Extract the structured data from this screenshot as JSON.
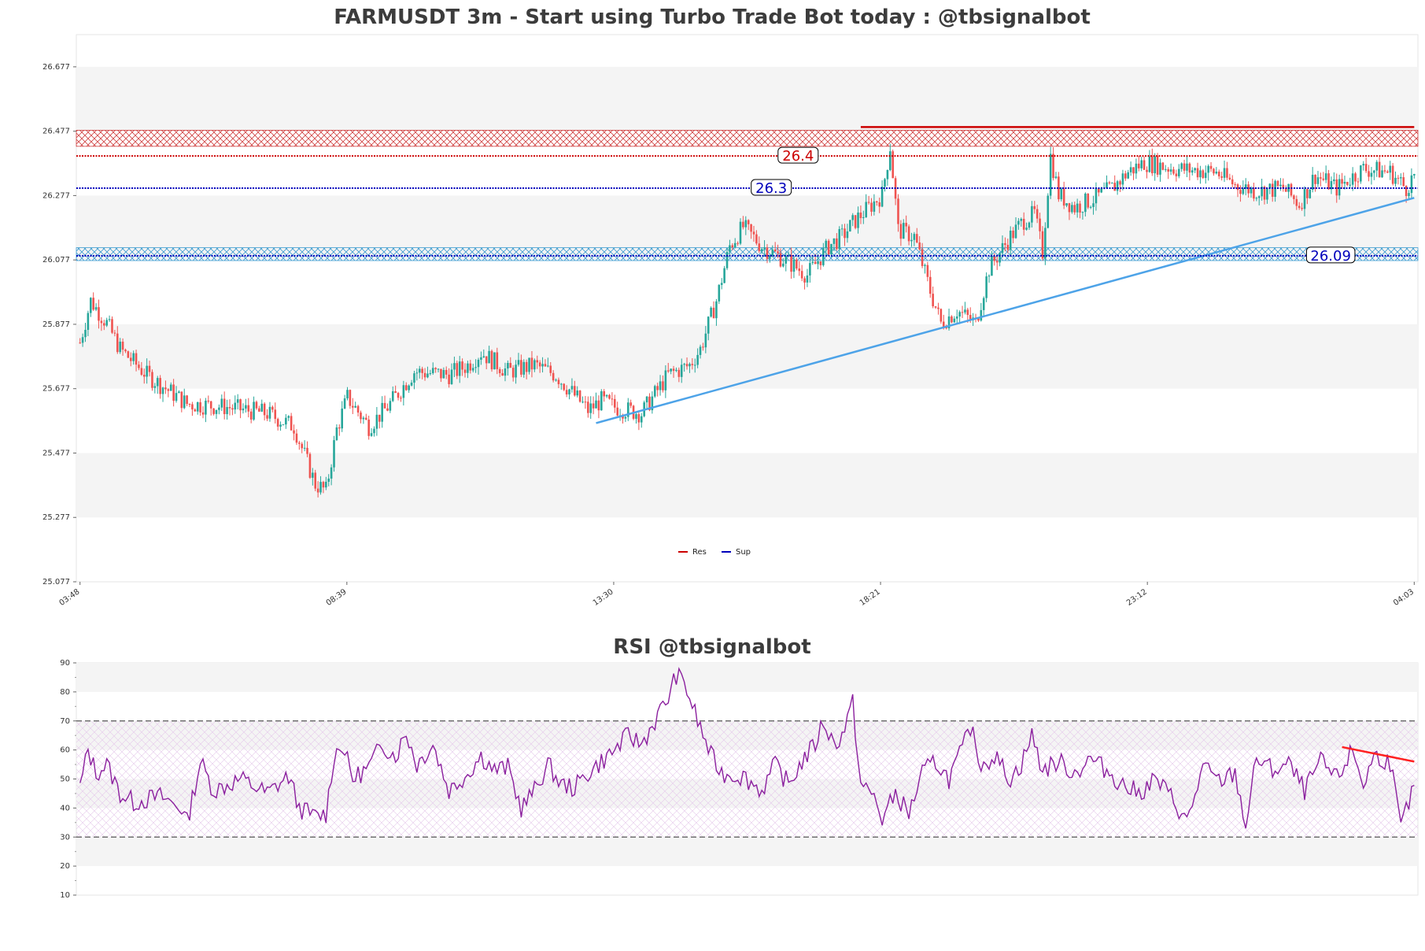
{
  "chart_data": [
    {
      "type": "candlestick",
      "title": "FARMUSDT 3m - Start using Turbo Trade Bot today : @tbsignalbot",
      "ylim": [
        25.077,
        26.777
      ],
      "y_ticks": [
        25.077,
        25.277,
        25.477,
        25.677,
        25.877,
        26.077,
        26.277,
        26.477,
        26.677
      ],
      "x_ticks": [
        "03:48",
        "08:39",
        "13:30",
        "18:21",
        "23:12",
        "04:03"
      ],
      "candle_count": 500,
      "price_path": [
        [
          0,
          25.82
        ],
        [
          4,
          25.95
        ],
        [
          10,
          25.88
        ],
        [
          15,
          25.8
        ],
        [
          25,
          25.72
        ],
        [
          40,
          25.63
        ],
        [
          55,
          25.62
        ],
        [
          70,
          25.6
        ],
        [
          80,
          25.56
        ],
        [
          88,
          25.38
        ],
        [
          92,
          25.36
        ],
        [
          96,
          25.55
        ],
        [
          100,
          25.65
        ],
        [
          108,
          25.56
        ],
        [
          115,
          25.62
        ],
        [
          125,
          25.73
        ],
        [
          138,
          25.72
        ],
        [
          145,
          25.75
        ],
        [
          150,
          25.79
        ],
        [
          160,
          25.73
        ],
        [
          170,
          25.75
        ],
        [
          178,
          25.72
        ],
        [
          190,
          25.61
        ],
        [
          195,
          25.64
        ],
        [
          200,
          25.62
        ],
        [
          210,
          25.6
        ],
        [
          215,
          25.66
        ],
        [
          220,
          25.72
        ],
        [
          228,
          25.75
        ],
        [
          232,
          25.8
        ],
        [
          238,
          25.95
        ],
        [
          243,
          26.12
        ],
        [
          248,
          26.18
        ],
        [
          255,
          26.12
        ],
        [
          265,
          26.07
        ],
        [
          272,
          26.03
        ],
        [
          280,
          26.12
        ],
        [
          285,
          26.15
        ],
        [
          290,
          26.2
        ],
        [
          295,
          26.24
        ],
        [
          300,
          26.28
        ],
        [
          303,
          26.43
        ],
        [
          306,
          26.17
        ],
        [
          312,
          26.15
        ],
        [
          318,
          25.98
        ],
        [
          322,
          25.88
        ],
        [
          328,
          25.92
        ],
        [
          335,
          25.88
        ],
        [
          340,
          26.05
        ],
        [
          348,
          26.15
        ],
        [
          353,
          26.2
        ],
        [
          357,
          26.22
        ],
        [
          360,
          26.1
        ],
        [
          363,
          26.4
        ],
        [
          366,
          26.28
        ],
        [
          372,
          26.24
        ],
        [
          380,
          26.27
        ],
        [
          386,
          26.3
        ],
        [
          392,
          26.35
        ],
        [
          398,
          26.38
        ],
        [
          410,
          26.36
        ],
        [
          425,
          26.35
        ],
        [
          432,
          26.31
        ],
        [
          440,
          26.29
        ],
        [
          450,
          26.3
        ],
        [
          456,
          26.25
        ],
        [
          462,
          26.34
        ],
        [
          470,
          26.3
        ],
        [
          480,
          26.36
        ],
        [
          490,
          26.35
        ],
        [
          496,
          26.3
        ],
        [
          499,
          26.34
        ]
      ],
      "levels": [
        {
          "name": "Res",
          "value": 26.4,
          "label": "26.4",
          "color": "#cc0000"
        },
        {
          "name": "Sup",
          "value": 26.3,
          "label": "26.3",
          "color": "#0000bb"
        },
        {
          "name": "Sup",
          "value": 26.09,
          "label": "26.09",
          "color": "#0000bb"
        }
      ],
      "zones": [
        {
          "from": 26.43,
          "to": 26.48,
          "color": "#d04040"
        },
        {
          "from": 26.075,
          "to": 26.115,
          "color": "#3a9ad0"
        }
      ],
      "trendlines": [
        {
          "from": [
            193,
            25.57
          ],
          "to": [
            499,
            26.27
          ],
          "color": "#4da3e8"
        },
        {
          "from": [
            292,
            26.49
          ],
          "to": [
            499,
            26.49
          ],
          "color": "#cc0000"
        }
      ],
      "legend": [
        {
          "label": "Res",
          "color": "#cc0000"
        },
        {
          "label": "Sup",
          "color": "#0000bb"
        }
      ],
      "colors": {
        "up": "#26a69a",
        "down": "#ef5350"
      }
    },
    {
      "type": "line",
      "title": "RSI @tbsignalbot",
      "ylim": [
        10,
        90
      ],
      "y_ticks": [
        10,
        20,
        30,
        40,
        50,
        60,
        70,
        80,
        90
      ],
      "reference_lines": [
        30,
        70
      ],
      "line_color": "#8b1f9e",
      "rsi_path": [
        [
          0,
          47
        ],
        [
          3,
          60
        ],
        [
          6,
          52
        ],
        [
          10,
          55
        ],
        [
          15,
          45
        ],
        [
          20,
          42
        ],
        [
          30,
          44
        ],
        [
          38,
          40
        ],
        [
          40,
          35
        ],
        [
          45,
          56
        ],
        [
          50,
          46
        ],
        [
          60,
          50
        ],
        [
          70,
          45
        ],
        [
          78,
          51
        ],
        [
          82,
          40
        ],
        [
          88,
          37
        ],
        [
          92,
          38
        ],
        [
          95,
          58
        ],
        [
          98,
          62
        ],
        [
          102,
          50
        ],
        [
          108,
          54
        ],
        [
          113,
          62
        ],
        [
          118,
          58
        ],
        [
          122,
          66
        ],
        [
          126,
          55
        ],
        [
          132,
          62
        ],
        [
          138,
          46
        ],
        [
          145,
          52
        ],
        [
          150,
          58
        ],
        [
          155,
          53
        ],
        [
          160,
          54
        ],
        [
          165,
          40
        ],
        [
          170,
          46
        ],
        [
          175,
          55
        ],
        [
          180,
          48
        ],
        [
          185,
          47
        ],
        [
          190,
          52
        ],
        [
          195,
          56
        ],
        [
          200,
          60
        ],
        [
          205,
          65
        ],
        [
          210,
          62
        ],
        [
          215,
          70
        ],
        [
          220,
          78
        ],
        [
          223,
          86
        ],
        [
          226,
          83
        ],
        [
          228,
          78
        ],
        [
          231,
          70
        ],
        [
          236,
          58
        ],
        [
          240,
          52
        ],
        [
          248,
          51
        ],
        [
          255,
          46
        ],
        [
          260,
          55
        ],
        [
          265,
          48
        ],
        [
          270,
          56
        ],
        [
          275,
          62
        ],
        [
          278,
          70
        ],
        [
          282,
          62
        ],
        [
          285,
          65
        ],
        [
          289,
          76
        ],
        [
          292,
          48
        ],
        [
          297,
          44
        ],
        [
          300,
          36
        ],
        [
          305,
          45
        ],
        [
          310,
          38
        ],
        [
          315,
          52
        ],
        [
          320,
          56
        ],
        [
          325,
          50
        ],
        [
          330,
          60
        ],
        [
          333,
          68
        ],
        [
          337,
          55
        ],
        [
          342,
          58
        ],
        [
          348,
          50
        ],
        [
          352,
          55
        ],
        [
          356,
          65
        ],
        [
          360,
          53
        ],
        [
          366,
          56
        ],
        [
          372,
          52
        ],
        [
          378,
          57
        ],
        [
          384,
          53
        ],
        [
          390,
          48
        ],
        [
          396,
          45
        ],
        [
          402,
          50
        ],
        [
          408,
          44
        ],
        [
          414,
          35
        ],
        [
          420,
          54
        ],
        [
          426,
          49
        ],
        [
          432,
          52
        ],
        [
          436,
          34
        ],
        [
          440,
          57
        ],
        [
          446,
          53
        ],
        [
          452,
          55
        ],
        [
          458,
          46
        ],
        [
          464,
          56
        ],
        [
          470,
          50
        ],
        [
          476,
          60
        ],
        [
          480,
          48
        ],
        [
          484,
          58
        ],
        [
          490,
          56
        ],
        [
          494,
          33
        ],
        [
          497,
          42
        ],
        [
          499,
          46
        ]
      ],
      "trendlines": [
        {
          "from": [
            472,
            61
          ],
          "to": [
            499,
            56
          ],
          "color": "#ff2020"
        }
      ]
    }
  ]
}
